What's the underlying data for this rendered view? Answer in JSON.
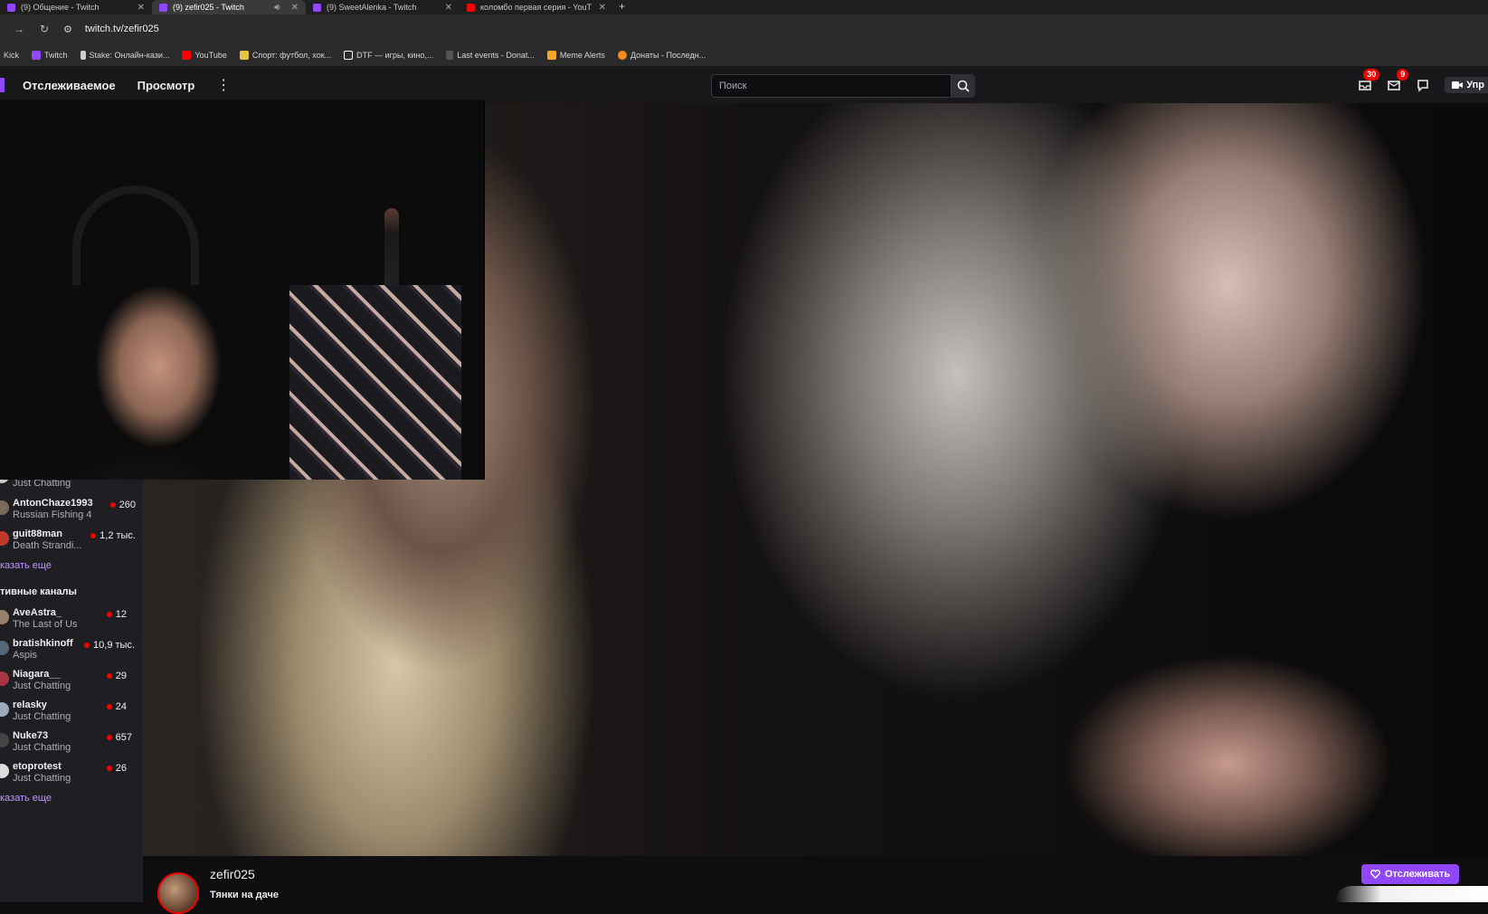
{
  "browser": {
    "tabs": [
      {
        "title": "(9) Общение - Twitch",
        "fav_color": "#9147ff"
      },
      {
        "title": "(9) zefir025 - Twitch",
        "fav_color": "#9147ff",
        "active": true
      },
      {
        "title": "(9) SweetAlenka - Twitch",
        "fav_color": "#9147ff"
      },
      {
        "title": "коломбо первая серия - YouT",
        "fav_color": "#ff0000"
      }
    ],
    "new_tab": "+",
    "url": "twitch.tv/zefir025",
    "bookmarks": [
      {
        "label": "Kick",
        "color": "#53fc18"
      },
      {
        "label": "Twitch",
        "color": "#9147ff"
      },
      {
        "label": "Stake: Онлайн-кази...",
        "color": "#cccccc"
      },
      {
        "label": "YouTube",
        "color": "#ff0000"
      },
      {
        "label": "Спорт: футбол, хок...",
        "color": "#e4c441"
      },
      {
        "label": "DTF — игры, кино,...",
        "color": "#ffffff"
      },
      {
        "label": "Last events - Donat...",
        "color": "#ffffff"
      },
      {
        "label": "Meme Alerts",
        "color": "#f5a623"
      },
      {
        "label": "Донаты - Последн...",
        "color": "#f68c1e"
      }
    ]
  },
  "topnav": {
    "following": "Отслеживаемое",
    "browse": "Просмотр",
    "more": "⋮",
    "search_placeholder": "Поиск",
    "notif_badge": "30",
    "inbox_badge": "9",
    "manage_label": "Упр"
  },
  "sidebar": {
    "followed": [
      {
        "name": "",
        "game": "Just Chatting",
        "viewers": "",
        "avatar": "#cccccc"
      },
      {
        "name": "AntonChaze1993",
        "game": "Russian Fishing 4",
        "viewers": "260",
        "avatar": "#7a6a5a"
      },
      {
        "name": "guit88man",
        "game": "Death Strandi...",
        "viewers": "1,2 тыс.",
        "avatar": "#c0392b"
      }
    ],
    "show_more_1": "казать еще",
    "recommended_heading": "тивные каналы",
    "recommended": [
      {
        "name": "AveAstra_",
        "game": "The Last of Us",
        "viewers": "12",
        "avatar": "#9a8070"
      },
      {
        "name": "bratishkinoff",
        "game": "Aspis",
        "viewers": "10,9 тыс.",
        "avatar": "#556677"
      },
      {
        "name": "Niagara__",
        "game": "Just Chatting",
        "viewers": "29",
        "avatar": "#aa3344"
      },
      {
        "name": "relasky",
        "game": "Just Chatting",
        "viewers": "24",
        "avatar": "#99aabb"
      },
      {
        "name": "Nuke73",
        "game": "Just Chatting",
        "viewers": "657",
        "avatar": "#444444"
      },
      {
        "name": "etoprotest",
        "game": "Just Chatting",
        "viewers": "26",
        "avatar": "#dddddd"
      }
    ],
    "show_more_2": "казать еще"
  },
  "channel": {
    "name": "zefir025",
    "title": "Тянки на даче",
    "follow_label": "Отслеживать"
  }
}
